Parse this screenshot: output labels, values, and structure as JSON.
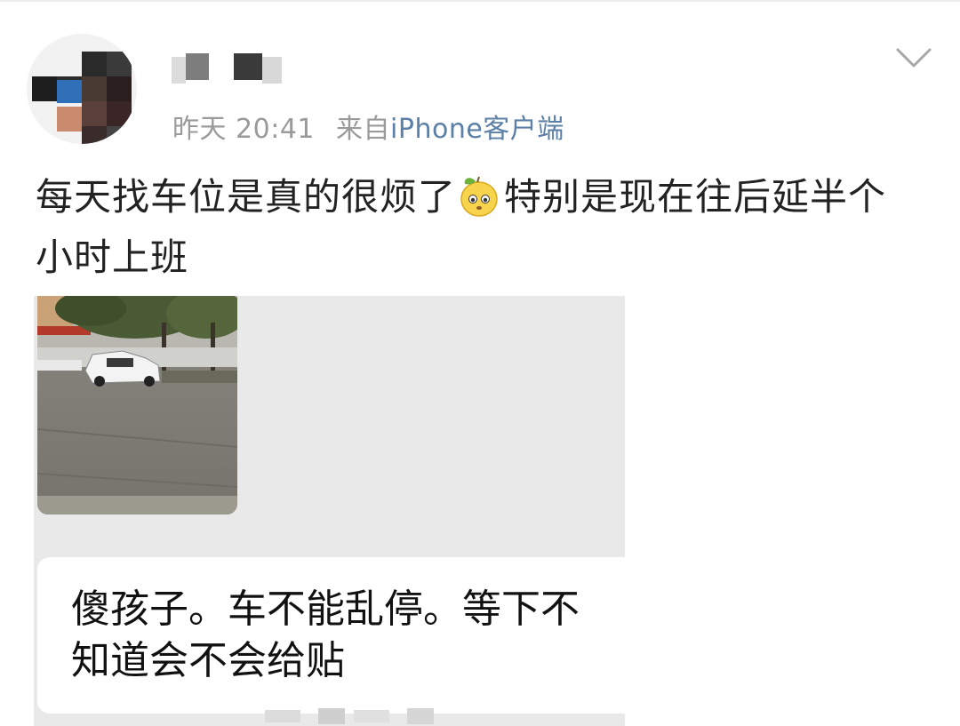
{
  "post": {
    "timestamp": "昨天 20:41",
    "source_prefix": "来自",
    "source_client": "iPhone客户端",
    "text_before_emoji": "每天找车位是真的很烦了",
    "emoji_name": "pear-face-emoji",
    "text_after_emoji": "特别是现在往后延半个小时上班"
  },
  "attachment": {
    "bubble_text": "傻孩子。车不能乱停。等下不\n知道会不会给贴"
  },
  "colors": {
    "meta_gray": "#9a9a9a",
    "source_link_blue": "#5b7fa6",
    "body_text": "#222222",
    "image_bg": "#e9e9e9"
  }
}
